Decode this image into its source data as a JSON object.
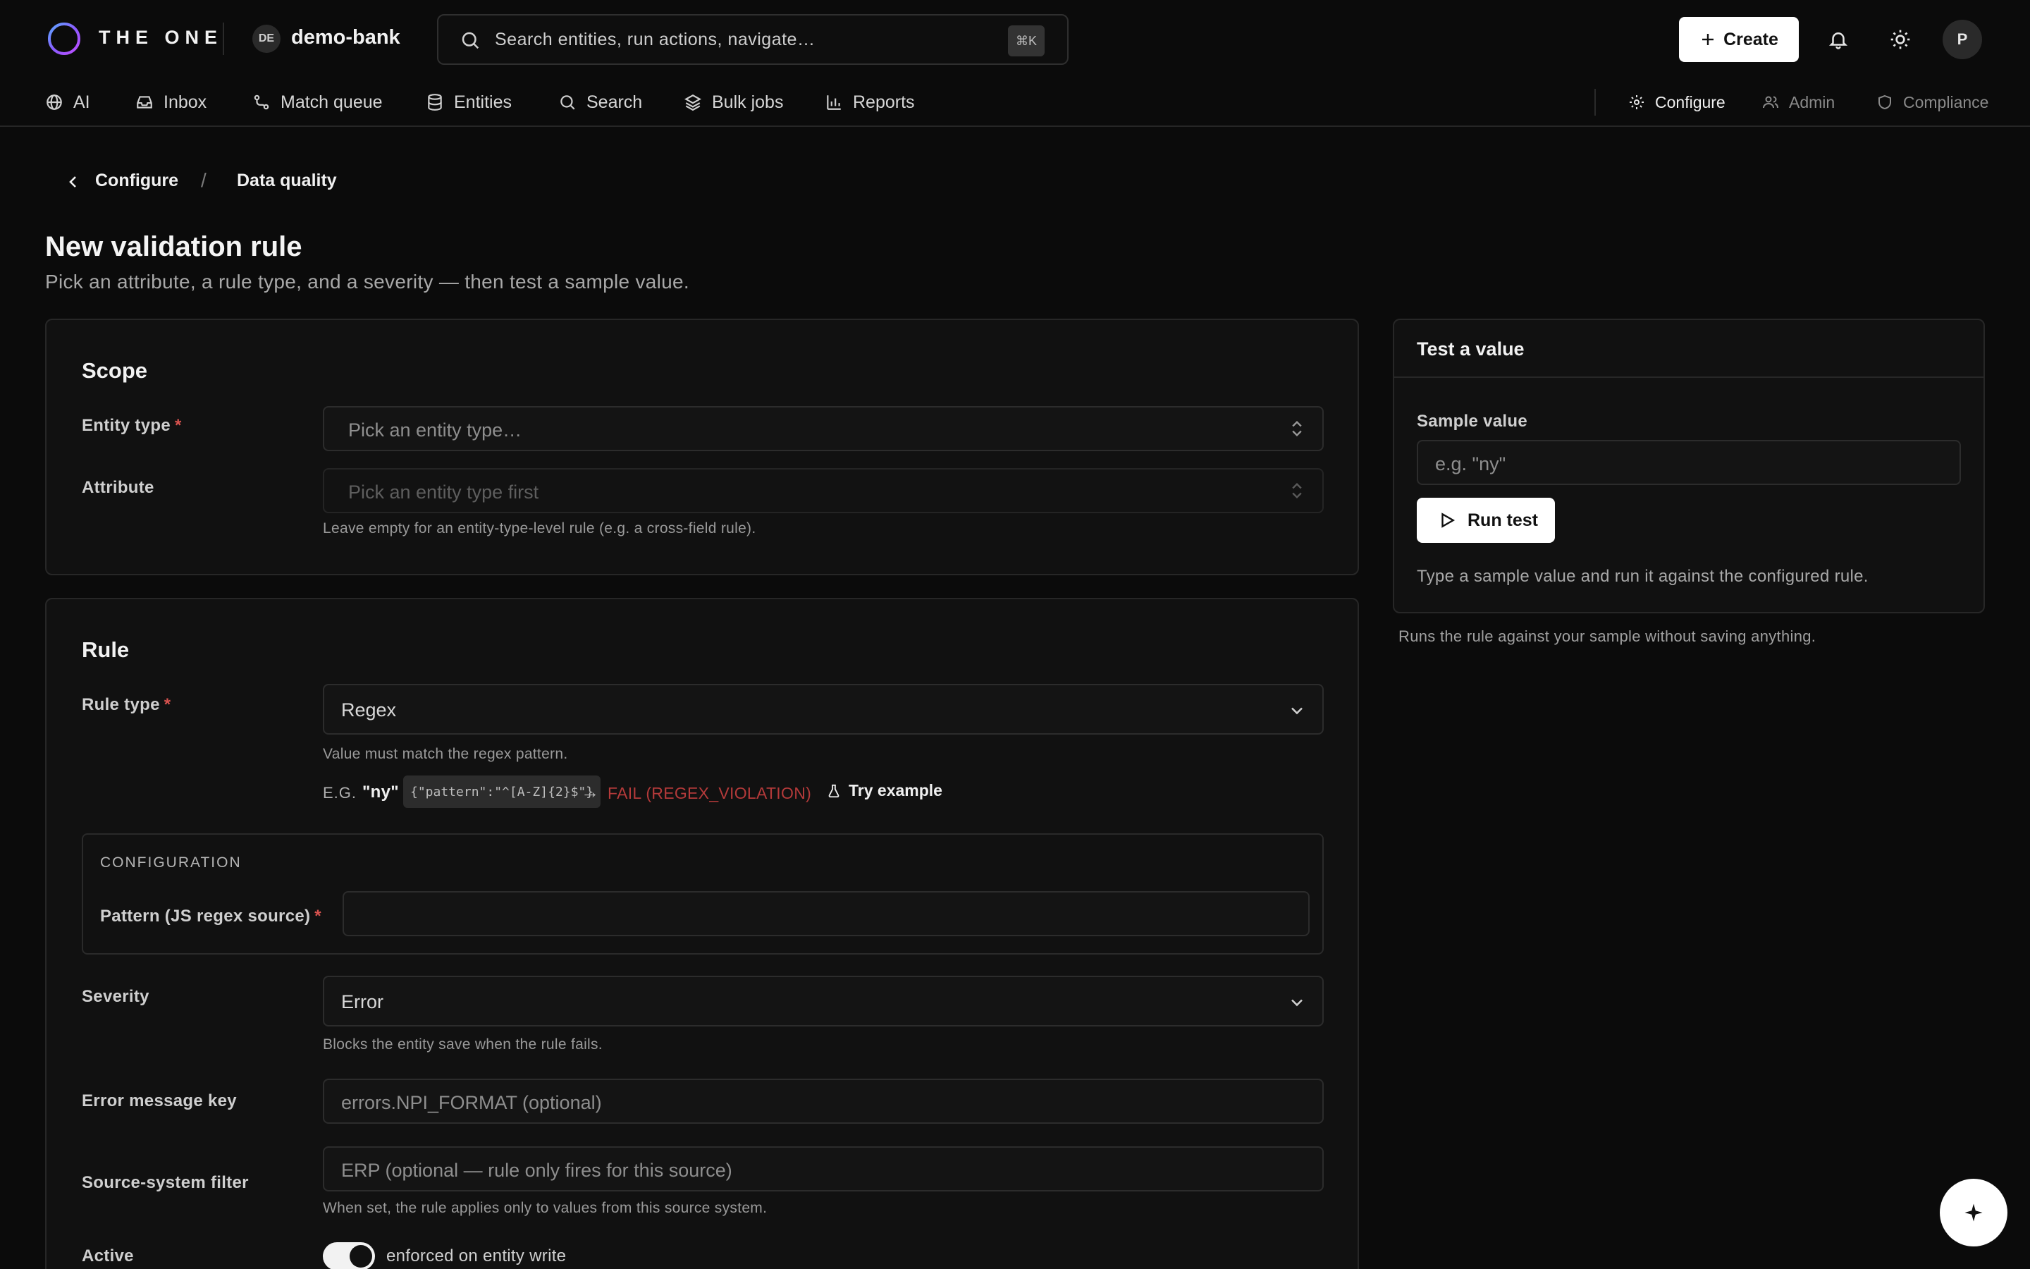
{
  "header": {
    "brand": "THE ONE",
    "workspace_badge": "DE",
    "workspace_name": "demo-bank",
    "search_placeholder": "Search entities, run actions, navigate…",
    "search_shortcut": "⌘K",
    "create_label": "Create",
    "avatar_initial": "P"
  },
  "nav": {
    "items": [
      {
        "label": "AI",
        "icon": "globe-icon"
      },
      {
        "label": "Inbox",
        "icon": "inbox-icon"
      },
      {
        "label": "Match queue",
        "icon": "route-icon"
      },
      {
        "label": "Entities",
        "icon": "database-icon"
      },
      {
        "label": "Search",
        "icon": "search-icon"
      },
      {
        "label": "Bulk jobs",
        "icon": "layers-icon"
      },
      {
        "label": "Reports",
        "icon": "bar-chart-icon"
      }
    ],
    "right": [
      {
        "label": "Configure",
        "icon": "gear-icon",
        "active": true
      },
      {
        "label": "Admin",
        "icon": "users-icon"
      },
      {
        "label": "Compliance",
        "icon": "shield-icon"
      }
    ]
  },
  "breadcrumb": {
    "parent": "Configure",
    "separator": "/",
    "current": "Data quality"
  },
  "page": {
    "title": "New validation rule",
    "subtitle": "Pick an attribute, a rule type, and a severity — then test a sample value."
  },
  "scope": {
    "title": "Scope",
    "entity_type_label": "Entity type",
    "entity_type_placeholder": "Pick an entity type…",
    "attribute_label": "Attribute",
    "attribute_placeholder": "Pick an entity type first",
    "attribute_help": "Leave empty for an entity-type-level rule (e.g. a cross-field rule)."
  },
  "rule": {
    "title": "Rule",
    "rule_type_label": "Rule type",
    "rule_type_value": "Regex",
    "rule_type_help": "Value must match the regex pattern.",
    "example_prefix": "E.G.",
    "example_value": "\"ny\"",
    "example_config": "{\"pattern\":\"^[A-Z]{2}$\"}",
    "example_arrow": "→",
    "example_result": "FAIL (REGEX_VIOLATION)",
    "try_example_label": "Try example",
    "config_title": "CONFIGURATION",
    "pattern_label": "Pattern (JS regex source)",
    "pattern_value": "",
    "severity_label": "Severity",
    "severity_value": "Error",
    "severity_help": "Blocks the entity save when the rule fails.",
    "error_key_label": "Error message key",
    "error_key_placeholder": "errors.NPI_FORMAT (optional)",
    "source_filter_label": "Source-system filter",
    "source_filter_placeholder": "ERP (optional — rule only fires for this source)",
    "source_filter_help": "When set, the rule applies only to values from this source system.",
    "active_label": "Active",
    "active_on": true,
    "active_help": "enforced on entity write"
  },
  "test_panel": {
    "title": "Test a value",
    "sample_label": "Sample value",
    "sample_placeholder": "e.g. \"ny\"",
    "run_label": "Run test",
    "hint": "Type a sample value and run it against the configured rule.",
    "footer": "Runs the rule against your sample without saving anything."
  },
  "fab_icon": "sparkle-icon"
}
